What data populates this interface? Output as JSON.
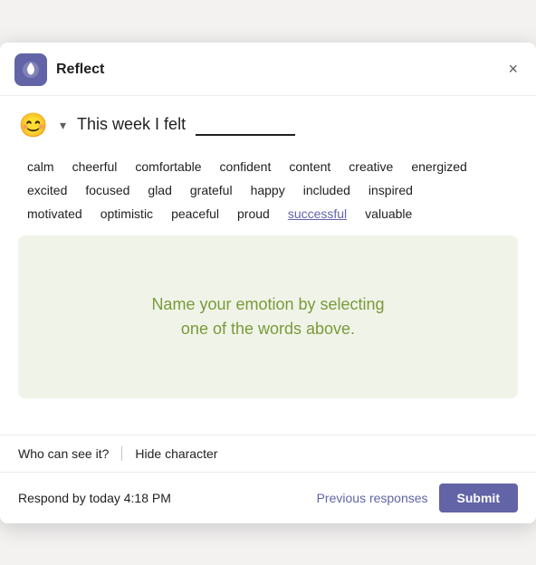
{
  "dialog": {
    "title": "Reflect",
    "close_label": "×"
  },
  "header": {
    "emoji": "😊",
    "chevron": "▾",
    "prompt_prefix": "This week I felt",
    "prompt_underline": "__________."
  },
  "words": {
    "row1": [
      "calm",
      "cheerful",
      "comfortable",
      "confident",
      "content",
      "creative",
      "energized"
    ],
    "row2": [
      "excited",
      "focused",
      "glad",
      "grateful",
      "happy",
      "included",
      "inspired"
    ],
    "row3": [
      "motivated",
      "optimistic",
      "peaceful",
      "proud",
      "successful",
      "valuable"
    ]
  },
  "emotion_box": {
    "line1": "Name your emotion by selecting",
    "line2": "one of the words above."
  },
  "footer": {
    "who_can_see": "Who can see it?",
    "hide_character": "Hide character",
    "respond_by": "Respond by today 4:18 PM",
    "previous_responses": "Previous responses",
    "submit": "Submit"
  }
}
